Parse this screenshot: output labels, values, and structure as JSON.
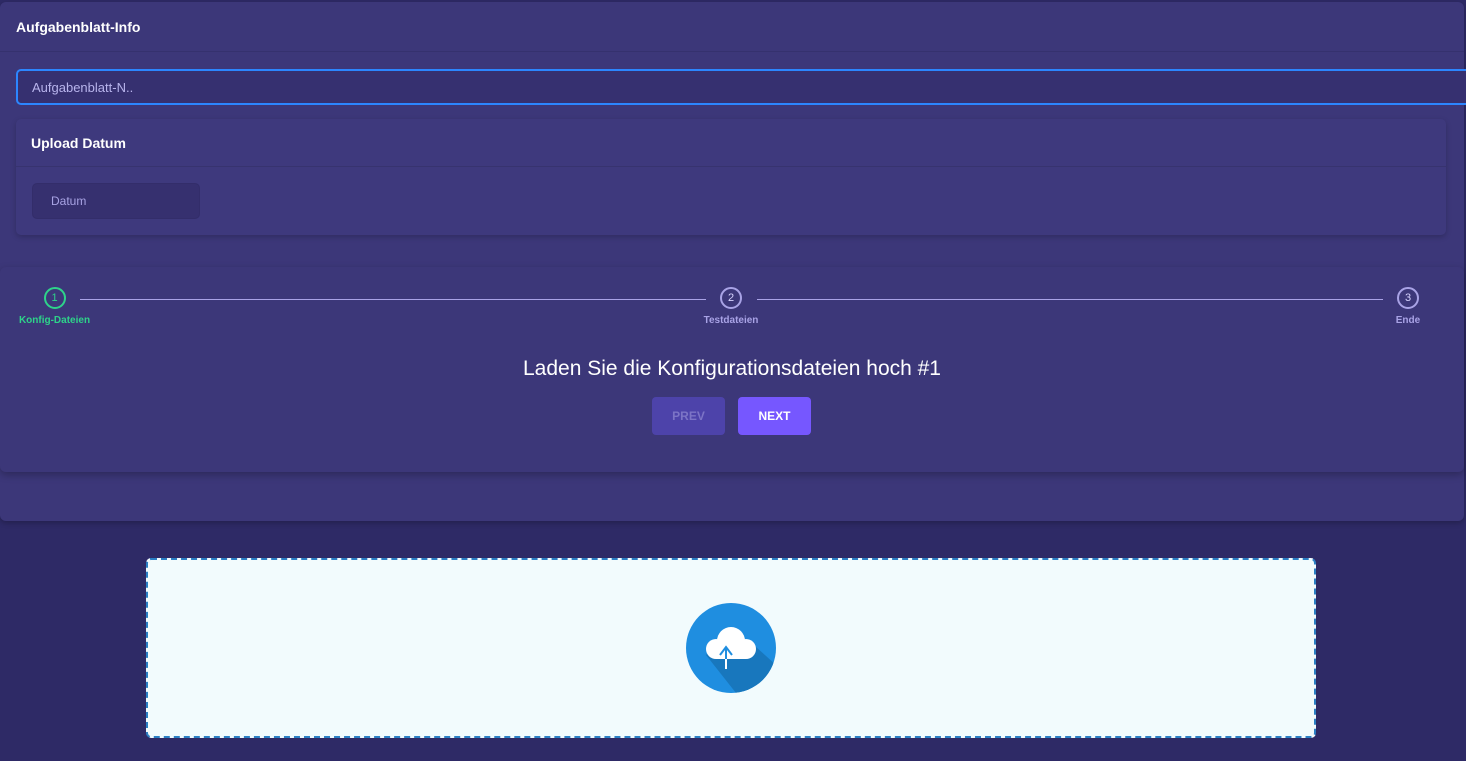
{
  "info_card": {
    "title": "Aufgabenblatt-Info",
    "name_placeholder": "Aufgabenblatt-N.."
  },
  "upload_date": {
    "title": "Upload Datum",
    "date_placeholder": "Datum"
  },
  "stepper": {
    "steps": [
      {
        "number": "1",
        "label": "Konfig-Dateien",
        "active": true
      },
      {
        "number": "2",
        "label": "Testdateien",
        "active": false
      },
      {
        "number": "3",
        "label": "Ende",
        "active": false
      }
    ],
    "heading": "Laden Sie die Konfigurationsdateien hoch #1",
    "prev_label": "PREV",
    "next_label": "NEXT"
  },
  "dropzone": {
    "icon": "cloud-upload-icon"
  },
  "colors": {
    "background": "#2e2a66",
    "card": "#3c3779",
    "active_step": "#2ed38a",
    "next_button": "#7657ff",
    "focus_border": "#2c86ff",
    "dropzone_bg": "#f2fbfd",
    "upload_icon": "#1f8ee0"
  }
}
